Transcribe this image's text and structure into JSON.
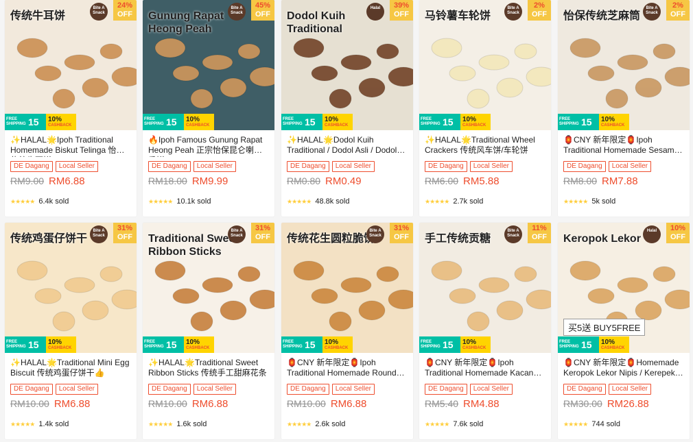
{
  "products": [
    {
      "name": "✨HALAL🌟Ipoh Traditional Homemade Biskut Telinga 怡保传统牛耳饼",
      "off": "24%",
      "off_label": "OFF",
      "tags": [
        "DE Dagang",
        "Local Seller"
      ],
      "old_price": "RM9.00",
      "price": "RM6.88",
      "sold": "6.4k sold",
      "art_text": "传统牛耳饼",
      "bg": "#f2e9dc",
      "accent": "#c98a4b",
      "logo": "Bite A Snack"
    },
    {
      "name": "🔥Ipoh Famous Gunung Rapat Heong Peah 正宗怡保昆仑喇叭香饼",
      "off": "45%",
      "off_label": "OFF",
      "tags": [
        "DE Dagang",
        "Local Seller"
      ],
      "old_price": "RM18.00",
      "price": "RM9.99",
      "sold": "10.1k sold",
      "art_text": "Gunung Rapat Heong Peah",
      "bg": "#3f5e66",
      "accent": "#d89a5b",
      "logo": "Bite A Snack"
    },
    {
      "name": "✨HALAL🌟Dodol Kuih Traditional / Dodol Asli / Dodol Durian",
      "off": "39%",
      "off_label": "OFF",
      "tags": [
        "DE Dagang",
        "Local Seller"
      ],
      "old_price": "RM0.80",
      "price": "RM0.49",
      "sold": "48.8k sold",
      "art_text": "Dodol Kuih Traditional",
      "bg": "#e6e0d2",
      "accent": "#6b3a1e",
      "logo": "Halal"
    },
    {
      "name": "✨HALAL🌟Traditional Wheel Crackers 传统风车饼/车轮饼",
      "off": "2%",
      "off_label": "OFF",
      "tags": [
        "DE Dagang",
        "Local Seller"
      ],
      "old_price": "RM6.00",
      "price": "RM5.88",
      "sold": "2.7k sold",
      "art_text": "马铃薯车轮饼",
      "bg": "#f4efe6",
      "accent": "#f3e7b8",
      "logo": "Bite A Snack"
    },
    {
      "name": "🏮CNY 新年限定🏮Ipoh Traditional Homemade Sesame Sticks",
      "off": "2%",
      "off_label": "OFF",
      "tags": [
        "DE Dagang",
        "Local Seller"
      ],
      "old_price": "RM8.00",
      "price": "RM7.88",
      "sold": "5k sold",
      "art_text": "怡保传统芝麻筒",
      "bg": "#efe9df",
      "accent": "#c7935a",
      "logo": "Bite A Snack"
    },
    {
      "name": "✨HALAL🌟Traditional Mini Egg Biscuit 传统鸡蛋仔饼干👍",
      "off": "31%",
      "off_label": "OFF",
      "tags": [
        "DE Dagang",
        "Local Seller"
      ],
      "old_price": "RM10.00",
      "price": "RM6.88",
      "sold": "1.4k sold",
      "art_text": "传统鸡蛋仔饼干",
      "bg": "#f7e7c9",
      "accent": "#f0c98c",
      "logo": "Bite A Snack"
    },
    {
      "name": "✨HALAL🌟Traditional Sweet Ribbon Sticks 传统手工甜麻花条",
      "off": "31%",
      "off_label": "OFF",
      "tags": [
        "DE Dagang",
        "Local Seller"
      ],
      "old_price": "RM10.00",
      "price": "RM6.88",
      "sold": "1.6k sold",
      "art_text": "Traditional Sweet Ribbon Sticks",
      "bg": "#f7f1e8",
      "accent": "#c47a34",
      "logo": "Bite A Snack"
    },
    {
      "name": "🏮CNY 新年限定🏮Ipoh Traditional Homemade Rounded Peanut Biscuit",
      "off": "31%",
      "off_label": "OFF",
      "tags": [
        "DE Dagang",
        "Local Seller"
      ],
      "old_price": "RM10.00",
      "price": "RM6.88",
      "sold": "2.6k sold",
      "art_text": "传统花生圆粒脆饼",
      "bg": "#f3e1c4",
      "accent": "#c98336",
      "logo": "Bite A Snack"
    },
    {
      "name": "🏮CNY 新年限定🏮Ipoh Traditional Homemade Kacang Tumbuk",
      "off": "11%",
      "off_label": "OFF",
      "tags": [
        "DE Dagang",
        "Local Seller"
      ],
      "old_price": "RM5.40",
      "price": "RM4.88",
      "sold": "7.6k sold",
      "art_text": "手工传统贡糖",
      "bg": "#f2ece2",
      "accent": "#e8b978",
      "logo": "Bite A Snack"
    },
    {
      "name": "🏮CNY 新年限定🏮Homemade Keropok Lekor Nipis / Kerepek Lekor",
      "off": "10%",
      "off_label": "OFF",
      "tags": [
        "DE Dagang",
        "Local Seller"
      ],
      "old_price": "RM30.00",
      "price": "RM26.88",
      "sold": "744 sold",
      "art_text": "Keropok Lekor",
      "bg": "#f6efe3",
      "accent": "#d9a15a",
      "logo": "Halal",
      "extra_banner": "买5送 BUY5FREE"
    }
  ],
  "promo": {
    "free_shipping": "FREE SHIPPING",
    "min_spend": "MIN. SPEND",
    "amount": "15",
    "cashback_pct": "10%",
    "cashback_label": "CASHBACK"
  },
  "stars_glyph": "★★★★★"
}
